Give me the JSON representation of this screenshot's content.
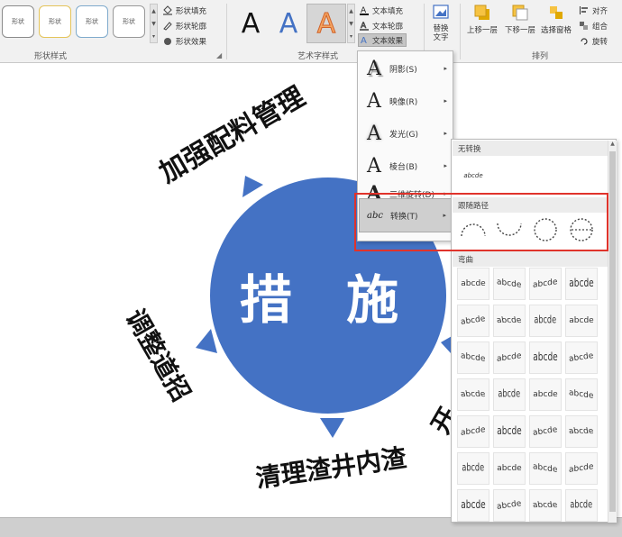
{
  "ribbon": {
    "shape_styles_label": "形状样式",
    "shape_style_tiles": [
      "形状",
      "形状",
      "形状",
      "形状"
    ],
    "shape_fill": "形状填充",
    "shape_outline": "形状轮廓",
    "shape_effects": "形状效果",
    "wordart_styles_label": "艺术字样式",
    "wordart_letter": "A",
    "text_fill": "文本填充",
    "text_outline": "文本轮廓",
    "text_effects": "文本效果",
    "alt_text": "替换文字",
    "bring_forward": "上移一层",
    "send_backward": "下移一层",
    "selection_pane": "选择窗格",
    "arrange_label": "排列",
    "align": "对齐",
    "group": "组合",
    "rotate": "旋转"
  },
  "slide": {
    "center_label": "措 施",
    "arc_top": "加强配料管理",
    "arc_left": "调整道招",
    "arc_bottom": "清理渣井内渣",
    "arc_right": "开"
  },
  "effects_menu": {
    "items": [
      {
        "label": "阴影(S)",
        "icon": "A"
      },
      {
        "label": "映像(R)",
        "icon": "A"
      },
      {
        "label": "发光(G)",
        "icon": "A"
      },
      {
        "label": "棱台(B)",
        "icon": "A"
      },
      {
        "label": "三维旋转(D)",
        "icon": "A"
      },
      {
        "label": "转换(T)",
        "icon": "abc"
      }
    ]
  },
  "transform_submenu": {
    "no_transform_header": "无转换",
    "no_transform_tile": "abcde",
    "follow_path_header": "跟随路径",
    "warp_header": "弯曲",
    "warp_tile_text": "abcde"
  },
  "colors": {
    "circle": "#4472c4",
    "arrow": "#4472c4",
    "highlight": "#e0332b",
    "wordart_blue": "#4472c4",
    "wordart_orange": "#f4a460"
  }
}
